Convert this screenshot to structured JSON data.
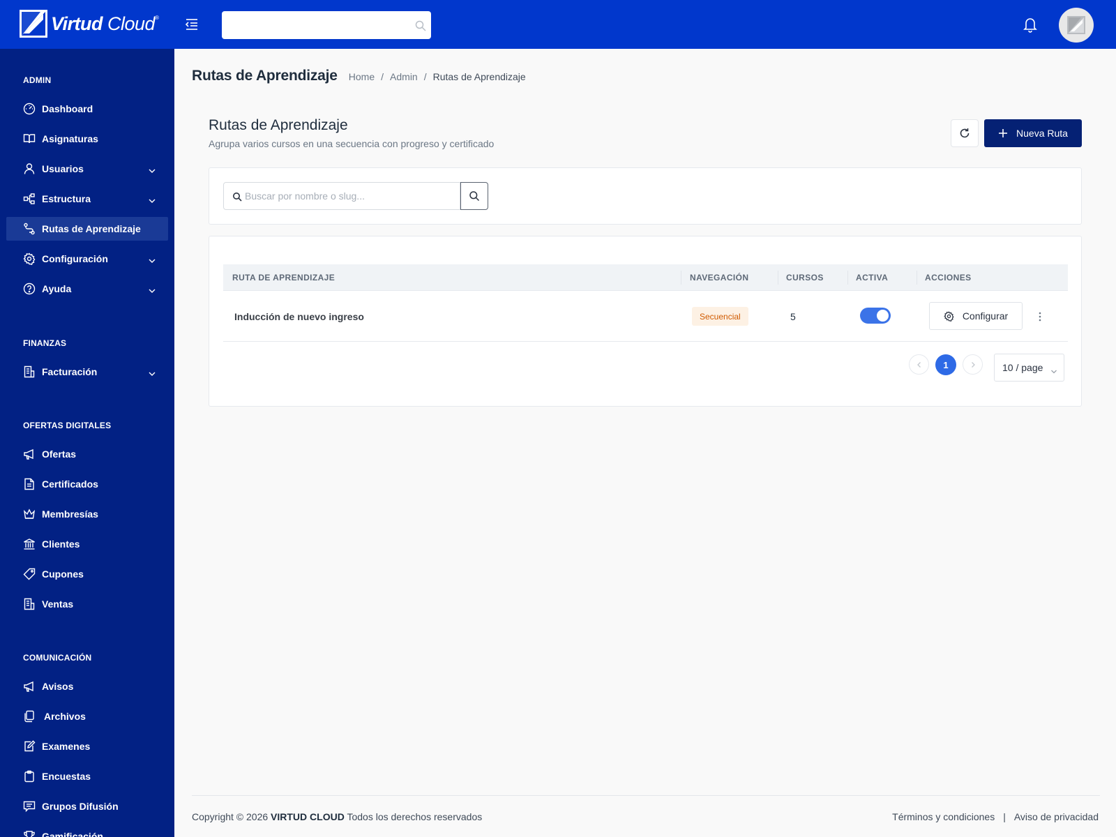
{
  "header": {
    "logo_bold": "Virtud",
    "logo_light": "Cloud",
    "logo_mark": "®",
    "search_value": "",
    "search_placeholder": ""
  },
  "sidebar": {
    "sections": [
      {
        "title": "ADMIN"
      },
      {
        "title": "FINANZAS"
      },
      {
        "title": "OFERTAS DIGITALES"
      },
      {
        "title": "COMUNICACIÓN"
      }
    ],
    "items": [
      {
        "label": "Dashboard",
        "icon": "dashboard-icon"
      },
      {
        "label": "Asignaturas",
        "icon": "book-icon"
      },
      {
        "label": "Usuarios",
        "icon": "user-icon",
        "expandable": true
      },
      {
        "label": "Estructura",
        "icon": "hierarchy-icon",
        "expandable": true
      },
      {
        "label": "Rutas de Aprendizaje",
        "icon": "route-icon",
        "active": true
      },
      {
        "label": "Configuración",
        "icon": "gear-icon",
        "expandable": true
      },
      {
        "label": "Ayuda",
        "icon": "help-icon",
        "expandable": true
      },
      {
        "label": "Facturación",
        "icon": "invoice-icon",
        "expandable": true
      },
      {
        "label": "Ofertas",
        "icon": "megaphone-icon"
      },
      {
        "label": "Certificados",
        "icon": "document-icon"
      },
      {
        "label": "Membresías",
        "icon": "crown-icon"
      },
      {
        "label": "Clientes",
        "icon": "bank-icon"
      },
      {
        "label": "Cupones",
        "icon": "tag-icon"
      },
      {
        "label": "Ventas",
        "icon": "receipt-icon"
      },
      {
        "label": "Avisos",
        "icon": "megaphone-icon"
      },
      {
        "label": "Archivos",
        "icon": "files-icon"
      },
      {
        "label": "Examenes",
        "icon": "edit-icon"
      },
      {
        "label": "Encuestas",
        "icon": "clipboard-icon"
      },
      {
        "label": "Grupos Difusión",
        "icon": "message-icon"
      },
      {
        "label": "Gamificación",
        "icon": "trophy-icon"
      }
    ]
  },
  "page": {
    "title": "Rutas de Aprendizaje",
    "breadcrumb": [
      "Home",
      "Admin",
      "Rutas de Aprendizaje"
    ],
    "breadcrumb_sep": "/"
  },
  "card": {
    "title": "Rutas de Aprendizaje",
    "subtitle": "Agrupa varios cursos en una secuencia con progreso y certificado",
    "new_button": "Nueva Ruta"
  },
  "filter": {
    "search_value": "",
    "search_placeholder": "Buscar por nombre o slug..."
  },
  "table": {
    "columns": [
      "RUTA DE APRENDIZAJE",
      "NAVEGACIÓN",
      "CURSOS",
      "ACTIVA",
      "ACCIONES"
    ],
    "rows": [
      {
        "name": "Inducción de nuevo ingreso",
        "navigation": "Secuencial",
        "courses": "5",
        "active": true,
        "action_label": "Configurar"
      }
    ]
  },
  "pagination": {
    "current_page": "1",
    "page_size": "10 / page"
  },
  "footer": {
    "copyright_prefix": "Copyright © 2026",
    "brand": "VIRTUD CLOUD",
    "copyright_suffix": "Todos los derechos reservados",
    "terms": "Términos y condiciones",
    "separator": "|",
    "privacy": "Aviso de privacidad"
  },
  "colors": {
    "header_bg": "#0137cc",
    "sidebar_bg": "#022184",
    "primary_button": "#052174",
    "toggle_on": "#3b73e8",
    "badge_text": "#d05a00",
    "badge_bg": "#fdf1e4"
  }
}
